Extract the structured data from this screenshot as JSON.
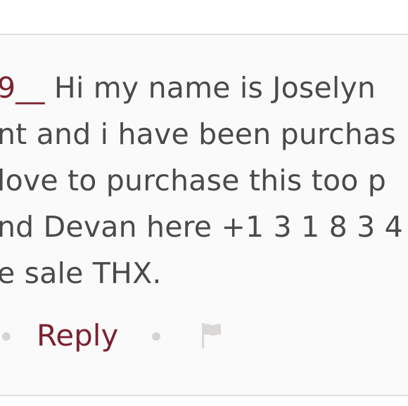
{
  "comment": {
    "mention_suffix": "9__",
    "line1_text": " Hi my name is Joselyn",
    "line2": "nt and i have been purchas",
    "line3": " love to purchase this too p",
    "line4": "nd Devan here +1 3 1 8 3 4",
    "line5": "e sale THX."
  },
  "actions": {
    "reply_label": "Reply",
    "flag_icon": "flag-icon"
  },
  "colors": {
    "accent": "#7b2230",
    "text": "#4a4a4a",
    "muted": "#d9d4d4",
    "border": "#e4dede"
  }
}
